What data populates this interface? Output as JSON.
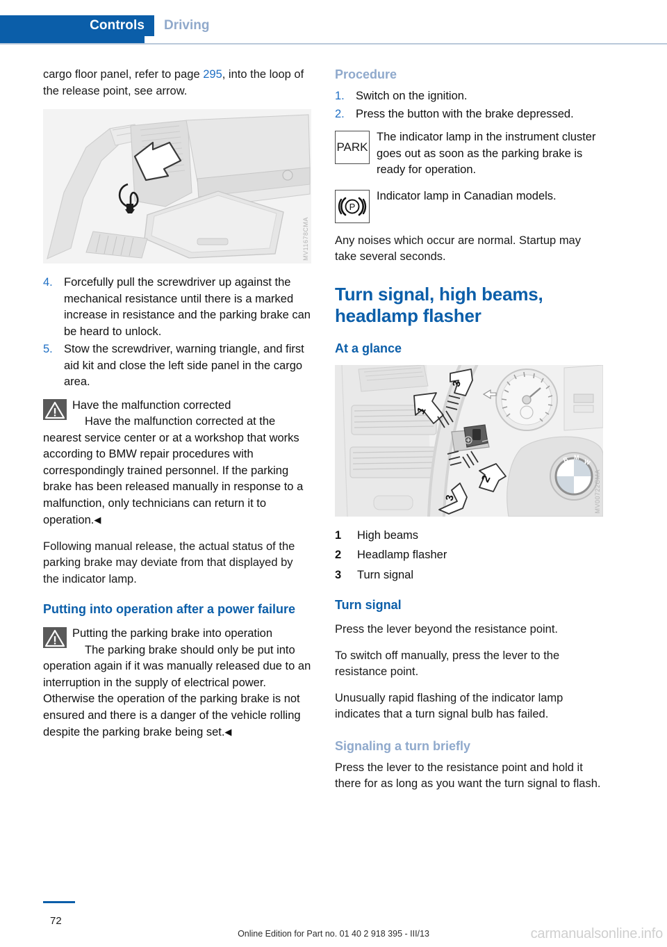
{
  "header": {
    "active_tab": "Controls",
    "inactive_tab": "Driving",
    "accent_color": "#0b5ea9",
    "inactive_color": "#90a9cb"
  },
  "left_column": {
    "intro_before_link": "cargo floor panel, refer to page ",
    "intro_link": "295",
    "intro_after_link": ", into the loop of the release point, see arrow.",
    "figure": {
      "code": "MV11678CMA",
      "alt": "Cargo area with white arrow pointing to parking brake release loop"
    },
    "steps": [
      {
        "num": "4.",
        "text": "Forcefully pull the screwdriver up against the mechanical resistance until there is a marked increase in resistance and the parking brake can be heard to unlock."
      },
      {
        "num": "5.",
        "text": "Stow the screwdriver, warning triangle, and first aid kit and close the left side panel in the cargo area."
      }
    ],
    "warning_1": {
      "icon": "warning-triangle-icon",
      "title": "Have the malfunction corrected",
      "body": "Have the malfunction corrected at the nearest service center or at a workshop that works according to BMW repair procedures with correspondingly trained personnel. If the parking brake has been released manually in response to a malfunction, only technicians can return it to operation.",
      "end_marker": "◀"
    },
    "paragraph_after_warning": "Following manual release, the actual status of the parking brake may deviate from that displayed by the indicator lamp.",
    "heading_power_failure": "Putting into operation after a power failure",
    "warning_2": {
      "icon": "warning-triangle-icon",
      "title": "Putting the parking brake into operation",
      "body": "The parking brake should only be put into operation again if it was manually released due to an interruption in the supply of electrical power. Otherwise the operation of the parking brake is not ensured and there is a danger of the vehicle rolling despite the parking brake being set.",
      "end_marker": "◀"
    }
  },
  "right_column": {
    "heading_procedure": "Procedure",
    "steps": [
      {
        "num": "1.",
        "text": "Switch on the ignition."
      },
      {
        "num": "2.",
        "text": "Press the button with the brake depressed."
      }
    ],
    "lamp_park": {
      "icon": "park-indicator-icon",
      "label": "PARK",
      "text": "The indicator lamp in the instrument cluster goes out as soon as the parking brake is ready for operation."
    },
    "lamp_canadian": {
      "icon": "parking-brake-p-icon",
      "label": "((P))",
      "text": "Indicator lamp in Canadian models."
    },
    "paragraph_noises": "Any noises which occur are normal. Startup may take several seconds.",
    "heading_turn_signal_main": "Turn signal, high beams, headlamp flasher",
    "heading_at_a_glance": "At a glance",
    "figure": {
      "code": "MV00722CMA",
      "alt": "Steering column stalk with numbered arrows for high beams, headlamp flasher and turn signal"
    },
    "legend": [
      {
        "num": "1",
        "text": "High beams"
      },
      {
        "num": "2",
        "text": "Headlamp flasher"
      },
      {
        "num": "3",
        "text": "Turn signal"
      }
    ],
    "heading_turn_signal": "Turn signal",
    "paragraph_press_lever": "Press the lever beyond the resistance point.",
    "paragraph_switch_off": "To switch off manually, press the lever to the resistance point.",
    "paragraph_rapid_flashing": "Unusually rapid flashing of the indicator lamp indicates that a turn signal bulb has failed.",
    "heading_signaling_briefly": "Signaling a turn briefly",
    "paragraph_signaling_briefly": "Press the lever to the resistance point and hold it there for as long as you want the turn signal to flash."
  },
  "footer": {
    "page_number": "72",
    "edition_text": "Online Edition for Part no. 01 40 2 918 395 - III/13",
    "watermark": "carmanualsonline.info"
  }
}
